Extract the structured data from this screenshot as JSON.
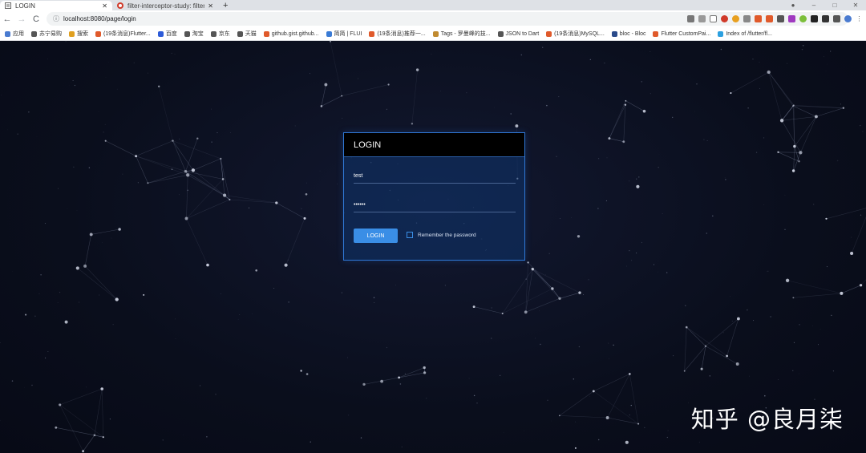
{
  "browser": {
    "tabs": [
      {
        "title": "LOGIN",
        "active": true
      },
      {
        "title": "filter-interceptor-study: filter-",
        "active": false
      }
    ],
    "url": "localhost:8080/page/login",
    "bookmarks": [
      {
        "label": "应用",
        "color": "#4a7bd0"
      },
      {
        "label": "苏宁易购",
        "color": "#555555"
      },
      {
        "label": "搜索",
        "color": "#e0a020"
      },
      {
        "label": "(19条消息)Flutter...",
        "color": "#e05a2b"
      },
      {
        "label": "百度",
        "color": "#2d5bd8"
      },
      {
        "label": "淘宝",
        "color": "#555555"
      },
      {
        "label": "京东",
        "color": "#555555"
      },
      {
        "label": "天猫",
        "color": "#555555"
      },
      {
        "label": "github.gist.github...",
        "color": "#e05a2b"
      },
      {
        "label": "简简 | FLUI",
        "color": "#3a7bd5"
      },
      {
        "label": "(19条消息)推荐一...",
        "color": "#e05a2b"
      },
      {
        "label": "Tags - 罗曼峰的技...",
        "color": "#c08a30"
      },
      {
        "label": "JSON to Dart",
        "color": "#555555"
      },
      {
        "label": "(19条消息)MySQL...",
        "color": "#e05a2b"
      },
      {
        "label": "bloc - Bloc",
        "color": "#2a4a8a"
      },
      {
        "label": "Flutter CustomPai...",
        "color": "#e05a2b"
      },
      {
        "label": "Index of /flutter/fl...",
        "color": "#2ca0e0"
      }
    ]
  },
  "login": {
    "title": "LOGIN",
    "username_value": "test",
    "password_value": "••••••",
    "button_label": "LOGIN",
    "remember_label": "Remember the password",
    "remember_checked": false
  },
  "watermark": "知乎 @良月柒",
  "colors": {
    "accent": "#3a8ee6",
    "card_border": "#2f78d6",
    "background": "#0b0f1d"
  }
}
